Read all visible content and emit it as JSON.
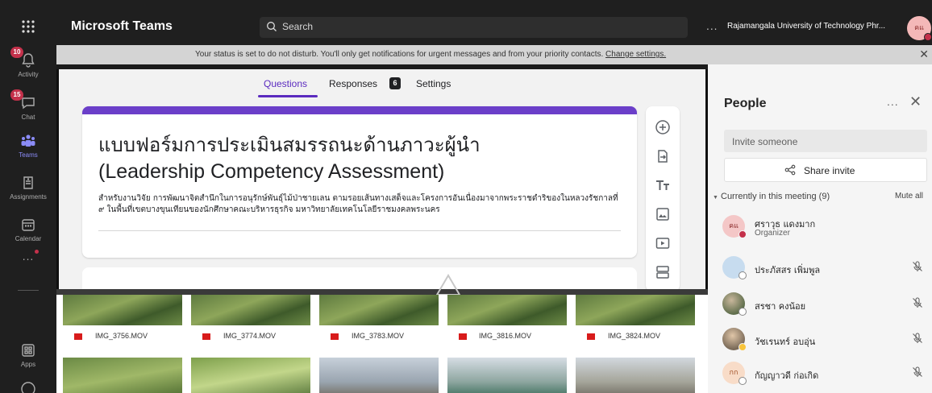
{
  "rail": {
    "items": [
      {
        "label": "Activity",
        "badge": "10",
        "icon": "bell-icon"
      },
      {
        "label": "Chat",
        "badge": "15",
        "icon": "chat-icon"
      },
      {
        "label": "Teams",
        "badge": "",
        "icon": "teams-icon"
      },
      {
        "label": "Assignments",
        "badge": "",
        "icon": "assignments-icon"
      },
      {
        "label": "Calendar",
        "badge": "",
        "icon": "calendar-icon"
      },
      {
        "label": "Apps",
        "badge": "",
        "icon": "apps-icon"
      }
    ],
    "more": "...",
    "app_launcher_icon": "waffle-icon",
    "help_icon": "help-icon"
  },
  "topbar": {
    "app_title": "Microsoft Teams",
    "search_placeholder": "Search",
    "more": "...",
    "org_name": "Rajamangala University of Technology Phr...",
    "avatar_initials": "คแ",
    "status_color": "#c4314b"
  },
  "notice": {
    "text": "Your status is set to do not disturb. You'll only get notifications for urgent messages and from your priority contacts.",
    "link": "Change settings."
  },
  "form": {
    "tabs": {
      "questions": "Questions",
      "responses": "Responses",
      "responses_count": "6",
      "settings": "Settings"
    },
    "title_th": "แบบฟอร์มการประเมินสมรรถนะด้านภาวะผู้นำ",
    "title_en": "(Leadership Competency Assessment)",
    "description": "สำหรับงานวิจัย การพัฒนาจิตสำนึกในการอนุรักษ์พันธุ์ไม้ป่าชายเลน ตามรอยเส้นทางเสด็จและโครงการอันเนื่องมาจากพระราชดำริของในหลวงรัชกาลที่ ๙ ในพื้นที่เขตบางขุนเทียนของนักศึกษาคณะบริหารธุรกิจ มหาวิทยาลัยเทคโนโลยีราชมงคลพระนคร",
    "accent": "#6b3fc9",
    "tools": [
      "add-question-icon",
      "import-questions-icon",
      "title-text-icon",
      "image-icon",
      "video-icon",
      "section-icon"
    ]
  },
  "gallery": {
    "files": [
      "IMG_3756.MOV",
      "IMG_3774.MOV",
      "IMG_3783.MOV",
      "IMG_3816.MOV",
      "IMG_3824.MOV"
    ]
  },
  "people": {
    "title": "People",
    "more": "...",
    "invite_placeholder": "Invite someone",
    "share_label": "Share invite",
    "meeting_header": "Currently in this meeting (9)",
    "mute_all": "Mute all",
    "participants": [
      {
        "name": "ศราวุธ แดงมาก",
        "role": "Organizer",
        "initials": "คแ",
        "avatar_color": "#f4c7c7",
        "status": "dnd"
      },
      {
        "name": "ประภัสสร เพิ่มพูล",
        "role": "",
        "initials": "",
        "avatar_color": "#c7dcef",
        "status": "offline"
      },
      {
        "name": "สรชา คงน้อย",
        "role": "",
        "initials": "",
        "avatar_color": "#7a8a6a",
        "status": "offline"
      },
      {
        "name": "วัชเรนทร์ อบอุ่น",
        "role": "",
        "initials": "",
        "avatar_color": "#b9a48a",
        "status": "away"
      },
      {
        "name": "กัญญาวดี ก่อเกิด",
        "role": "",
        "initials": "กก",
        "avatar_color": "#f8dcc8",
        "status": "offline"
      }
    ]
  }
}
